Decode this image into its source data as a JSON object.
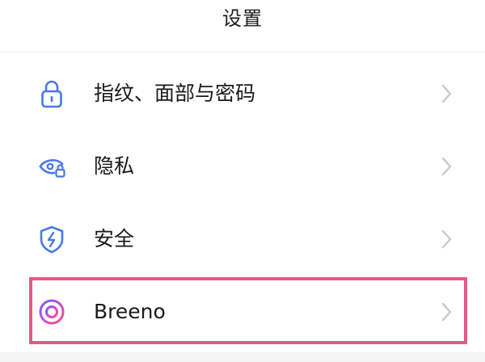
{
  "header": {
    "title": "设置"
  },
  "settings": {
    "items": [
      {
        "label": "指纹、面部与密码",
        "icon": "lock-icon",
        "icon_color": "#4a78e6"
      },
      {
        "label": "隐私",
        "icon": "privacy-eye-lock-icon",
        "icon_color": "#4a78e6"
      },
      {
        "label": "安全",
        "icon": "security-shield-icon",
        "icon_color": "#4a78e6"
      },
      {
        "label": "Breeno",
        "icon": "breeno-ring-icon",
        "icon_color": "#b55fdc"
      }
    ]
  },
  "colors": {
    "highlight": "#e8578a",
    "chevron": "#c8c8c8",
    "text": "#1a1a1a"
  }
}
